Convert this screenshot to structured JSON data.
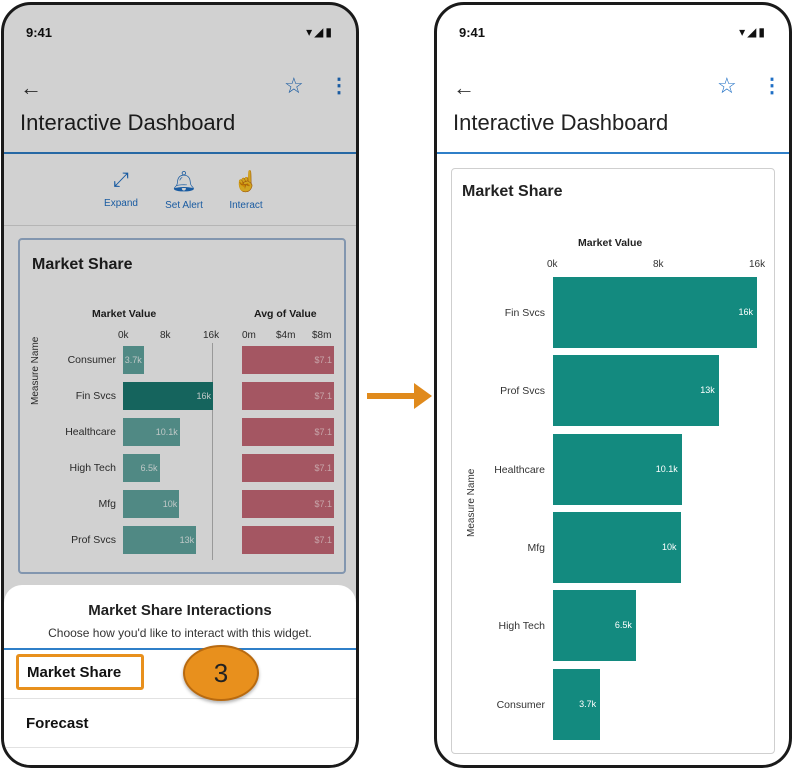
{
  "status": {
    "time": "9:41",
    "icons": "▾◢▮"
  },
  "header": {
    "title": "Interactive Dashboard"
  },
  "toolbar": {
    "expand": "Expand",
    "alert": "Set Alert",
    "interact": "Interact"
  },
  "widget": {
    "title": "Market Share"
  },
  "left_chart": {
    "y_axis_label": "Measure Name",
    "market_value": {
      "title": "Market Value",
      "ticks": [
        "0k",
        "8k",
        "16k"
      ]
    },
    "avg_value": {
      "title": "Avg of Value",
      "ticks": [
        "0m",
        "$4m",
        "$8m"
      ]
    }
  },
  "sheet": {
    "title": "Market Share Interactions",
    "subtitle": "Choose how you'd like to interact with this widget.",
    "options": [
      "Market Share",
      "Forecast"
    ]
  },
  "callout": {
    "number": "3"
  },
  "chart_data": [
    {
      "type": "bar",
      "title": "Market Share",
      "xlabel": "Market Value",
      "ylabel": "Measure Name",
      "categories": [
        "Consumer",
        "Fin Svcs",
        "Healthcare",
        "High Tech",
        "Mfg",
        "Prof Svcs"
      ],
      "values": [
        3.7,
        16,
        10.1,
        6.5,
        10,
        13
      ],
      "value_labels": [
        "3.7k",
        "16k",
        "10.1k",
        "6.5k",
        "10k",
        "13k"
      ],
      "xlim": [
        0,
        16
      ],
      "avg_values_labels": [
        "$7.1",
        "$7.1",
        "$7.1",
        "$7.1",
        "$7.1",
        "$7.1"
      ]
    },
    {
      "type": "bar",
      "title": "Market Share",
      "xlabel": "Market Value",
      "ylabel": "Measure Name",
      "ticks": [
        "0k",
        "8k",
        "16k"
      ],
      "categories": [
        "Fin Svcs",
        "Prof Svcs",
        "Healthcare",
        "Mfg",
        "High Tech",
        "Consumer"
      ],
      "values": [
        16,
        13,
        10.1,
        10,
        6.5,
        3.7
      ],
      "value_labels": [
        "16k",
        "13k",
        "10.1k",
        "10k",
        "6.5k",
        "3.7k"
      ],
      "xlim": [
        0,
        16
      ]
    }
  ]
}
